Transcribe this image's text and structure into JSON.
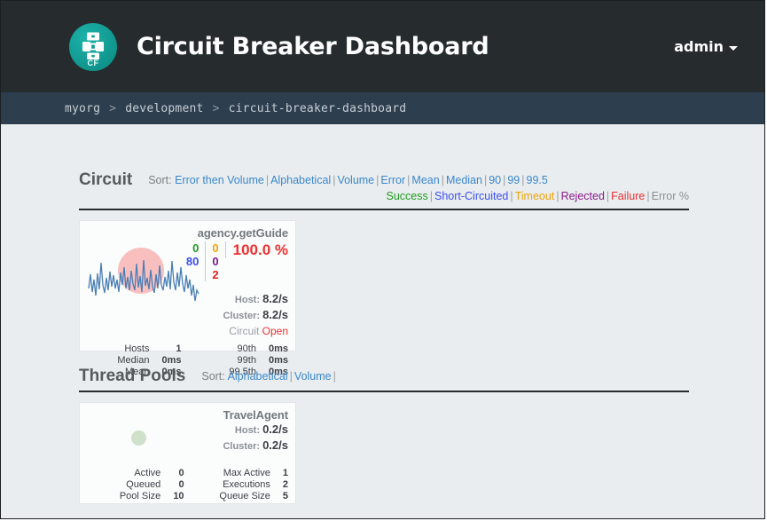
{
  "header": {
    "title": "Circuit Breaker Dashboard",
    "logo_text": "CF",
    "logo_icon": "circuit-breaker-icon",
    "user": "admin"
  },
  "breadcrumb": {
    "items": [
      "myorg",
      "development",
      "circuit-breaker-dashboard"
    ],
    "separator": ">"
  },
  "circuit_section": {
    "title": "Circuit",
    "sort_label": "Sort:",
    "sort_options": [
      "Error then Volume",
      "Alphabetical",
      "Volume",
      "Error",
      "Mean",
      "Median",
      "90",
      "99",
      "99.5"
    ],
    "legend": [
      {
        "label": "Success",
        "color": "#1f9c1f"
      },
      {
        "label": "Short-Circuited",
        "color": "#3b4ef0"
      },
      {
        "label": "Timeout",
        "color": "#f0a30a"
      },
      {
        "label": "Rejected",
        "color": "#8b1a8b"
      },
      {
        "label": "Failure",
        "color": "#f03030"
      },
      {
        "label": "Error %",
        "color": "#8a8f94"
      }
    ],
    "card": {
      "name": "agency.getGuide",
      "counters": {
        "success": "0",
        "short_circuited": "80",
        "timeout": "0",
        "rejected": "0",
        "failure": "2"
      },
      "error_percent": "100.0 %",
      "host_label": "Host:",
      "host_rate": "8.2/s",
      "cluster_label": "Cluster:",
      "cluster_rate": "8.2/s",
      "circuit_label": "Circuit",
      "circuit_state": "Open",
      "stats": {
        "hosts_key": "Hosts",
        "hosts_val": "1",
        "median_key": "Median",
        "median_val": "0ms",
        "mean_key": "Mean",
        "mean_val": "0ms",
        "p90_key": "90th",
        "p90_val": "0ms",
        "p99_key": "99th",
        "p99_val": "0ms",
        "p995_key": "99.5th",
        "p995_val": "0ms"
      }
    }
  },
  "threadpool_section": {
    "title": "Thread Pools",
    "sort_label": "Sort:",
    "sort_options": [
      "Alphabetical",
      "Volume"
    ],
    "card": {
      "name": "TravelAgent",
      "host_label": "Host:",
      "host_rate": "0.2/s",
      "cluster_label": "Cluster:",
      "cluster_rate": "0.2/s",
      "stats": {
        "active_key": "Active",
        "active_val": "0",
        "queued_key": "Queued",
        "queued_val": "0",
        "poolsize_key": "Pool Size",
        "poolsize_val": "10",
        "maxactive_key": "Max Active",
        "maxactive_val": "1",
        "executions_key": "Executions",
        "executions_val": "2",
        "queuesize_key": "Queue Size",
        "queuesize_val": "5"
      }
    }
  },
  "colors": {
    "header_bg": "#262b2e",
    "breadcrumb_bg": "#2d3e4f",
    "body_bg": "#e9edef",
    "brand_teal": "#14a098",
    "link_blue": "#3a87cd"
  }
}
